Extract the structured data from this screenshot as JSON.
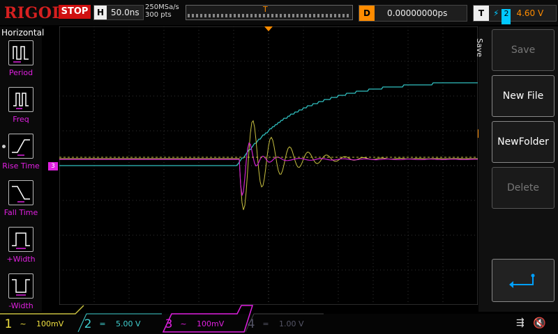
{
  "brand": "RIGOL",
  "run_state": "STOP",
  "timebase": {
    "key": "H",
    "value": "50.0ns"
  },
  "sample": {
    "rate": "250MSa/s",
    "points": "300 pts"
  },
  "trigger_marker": "T",
  "delay": {
    "key": "D",
    "value": "0.00000000ps"
  },
  "trigger": {
    "key": "T",
    "edge": "⚡",
    "channel": "2",
    "level": "4.60 V"
  },
  "left_menu": {
    "title": "Horizontal",
    "items": [
      {
        "label": "Period"
      },
      {
        "label": "Freq"
      },
      {
        "label": "Rise Time"
      },
      {
        "label": "Fall Time"
      },
      {
        "label": "+Width"
      },
      {
        "label": "-Width"
      }
    ]
  },
  "right_menu": {
    "tab": "Save",
    "buttons": [
      {
        "label": "Save",
        "enabled": false
      },
      {
        "label": "New File",
        "enabled": true
      },
      {
        "label": "NewFolder",
        "enabled": true
      },
      {
        "label": "Delete",
        "enabled": false
      }
    ]
  },
  "level_markers": {
    "left": "3",
    "right": "T"
  },
  "channels": [
    {
      "num": "1",
      "coupling": "~",
      "scale": "100mV",
      "color": "#f0e040",
      "active": true
    },
    {
      "num": "2",
      "coupling": "=",
      "scale": "5.00 V",
      "color": "#40d0d0",
      "active": true
    },
    {
      "num": "3",
      "coupling": "~",
      "scale": "100mV",
      "color": "#e020e0",
      "active": true
    },
    {
      "num": "4",
      "coupling": "=",
      "scale": "1.00 V",
      "color": "#555566",
      "active": false
    }
  ],
  "colors": {
    "ch1": "#c8c040",
    "ch2": "#30c0c0",
    "ch3": "#d020d0",
    "trigger": "#ff8c00",
    "stop": "#d01010"
  }
}
